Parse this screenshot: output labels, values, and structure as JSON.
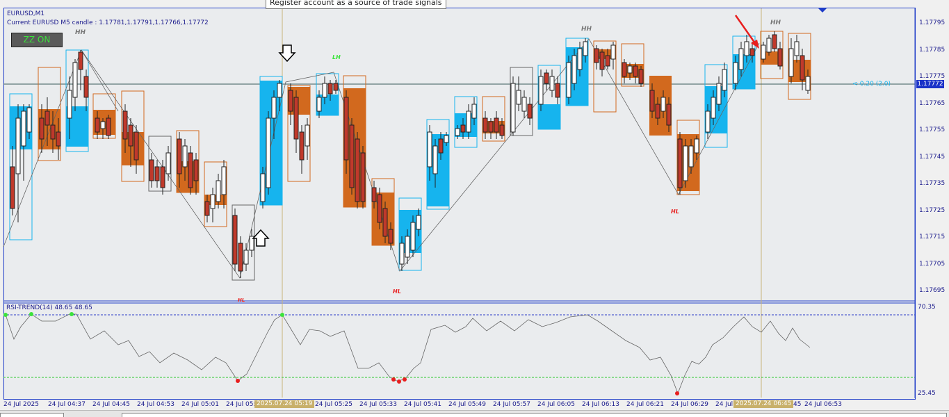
{
  "chart": {
    "symbol_label": "EURUSD,M1",
    "candle_info": "Current EURUSD M5 candle : 1.17781,1.17791,1.17766,1.17772",
    "zz_button": "ZZ ON",
    "tooltip": "Register account as a source of trade signals",
    "current_price": "1.17772",
    "spread_label": "<-0.20 (2.0)",
    "price_ticks": [
      "1.17795",
      "1.17785",
      "1.17775",
      "1.17765",
      "1.17755",
      "1.17745",
      "1.17735",
      "1.17725",
      "1.17715",
      "1.17705",
      "1.17695"
    ],
    "time_ticks": [
      "24 Jul 2025",
      "24 Jul 04:37",
      "24 Jul 04:45",
      "24 Jul 04:53",
      "24 Jul 05:01",
      "24 Jul 05:0",
      "24 Jul 05:25",
      "24 Jul 05:33",
      "24 Jul 05:41",
      "24 Jul 05:49",
      "24 Jul 05:57",
      "24 Jul 06:05",
      "24 Jul 06:13",
      "24 Jul 06:21",
      "24 Jul 06:29",
      "24 Jul 06",
      "45",
      "24 Jul 06:53"
    ],
    "time_highlights": [
      "2025.07.24 05:19",
      "2025.07.24 06:45"
    ],
    "zigzag_labels": [
      "HH",
      "HH",
      "HH",
      "LH",
      "HL",
      "HL",
      "HL",
      "HL"
    ],
    "colors": {
      "bull_zone": "#16b4ee",
      "bear_zone": "#d2691e",
      "frame": "#1e3cc8",
      "arrow": "#e81e1e"
    }
  },
  "rsi": {
    "label": "RSI-TREND(14) 48.65 48.65",
    "levels": [
      "70.35",
      "25.45"
    ]
  }
}
